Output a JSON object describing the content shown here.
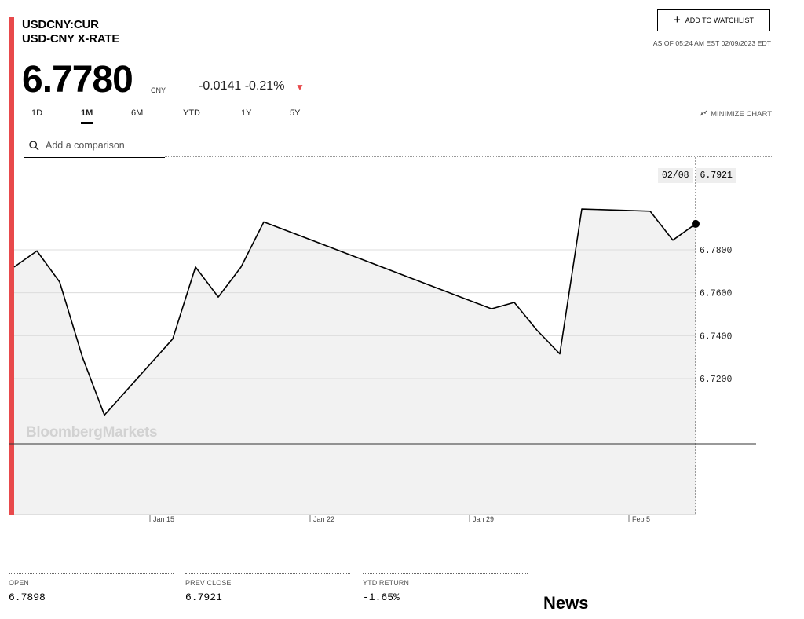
{
  "header": {
    "ticker": "USDCNY:CUR",
    "name": "USD-CNY X-RATE",
    "price": "6.7780",
    "currency": "CNY",
    "change": "-0.0141",
    "change_pct": "-0.21%",
    "change_direction_icon": "triangle-down-icon",
    "down_color": "#e8494b",
    "watchlist_label": "ADD TO WATCHLIST",
    "as_of": "AS OF 05:24 AM EST 02/09/2023 EDT"
  },
  "tabs": [
    {
      "label": "1D",
      "active": false
    },
    {
      "label": "1M",
      "active": true
    },
    {
      "label": "6M",
      "active": false
    },
    {
      "label": "YTD",
      "active": false
    },
    {
      "label": "1Y",
      "active": false
    },
    {
      "label": "5Y",
      "active": false
    }
  ],
  "minimize_label": "MINIMIZE CHART",
  "search": {
    "placeholder": "Add a comparison"
  },
  "tooltip": {
    "date": "02/08",
    "value": "6.7921"
  },
  "watermark": "BloombergMarkets",
  "chart_data": {
    "type": "area",
    "x": [
      "Jan 9",
      "Jan 10",
      "Jan 11",
      "Jan 12",
      "Jan 13",
      "Jan 16",
      "Jan 17",
      "Jan 18",
      "Jan 19",
      "Jan 20",
      "Jan 30",
      "Jan 31",
      "Feb 1",
      "Feb 2",
      "Feb 3",
      "Feb 6",
      "Feb 7",
      "Feb 8"
    ],
    "series": [
      {
        "values": [
          6.772,
          6.7795,
          6.765,
          6.73,
          6.703,
          6.7385,
          6.772,
          6.758,
          6.772,
          6.793,
          6.7525,
          6.7555,
          6.7425,
          6.7315,
          6.799,
          6.798,
          6.7845,
          6.7921
        ]
      }
    ],
    "y_ticks": [
      "6.7200",
      "6.7400",
      "6.7600",
      "6.7800"
    ],
    "x_ticks": [
      "Jan 15",
      "Jan 22",
      "Jan 29",
      "Feb 5"
    ],
    "ylim": [
      6.66,
      6.82
    ],
    "grid": true,
    "line_color": "#000000",
    "fill_color": "#f2f2f2",
    "accent": "#e8494b"
  },
  "stats": [
    {
      "label": "OPEN",
      "value": "6.7898"
    },
    {
      "label": "PREV CLOSE",
      "value": "6.7921"
    },
    {
      "label": "YTD RETURN",
      "value": "-1.65%"
    }
  ],
  "news_heading": "News"
}
